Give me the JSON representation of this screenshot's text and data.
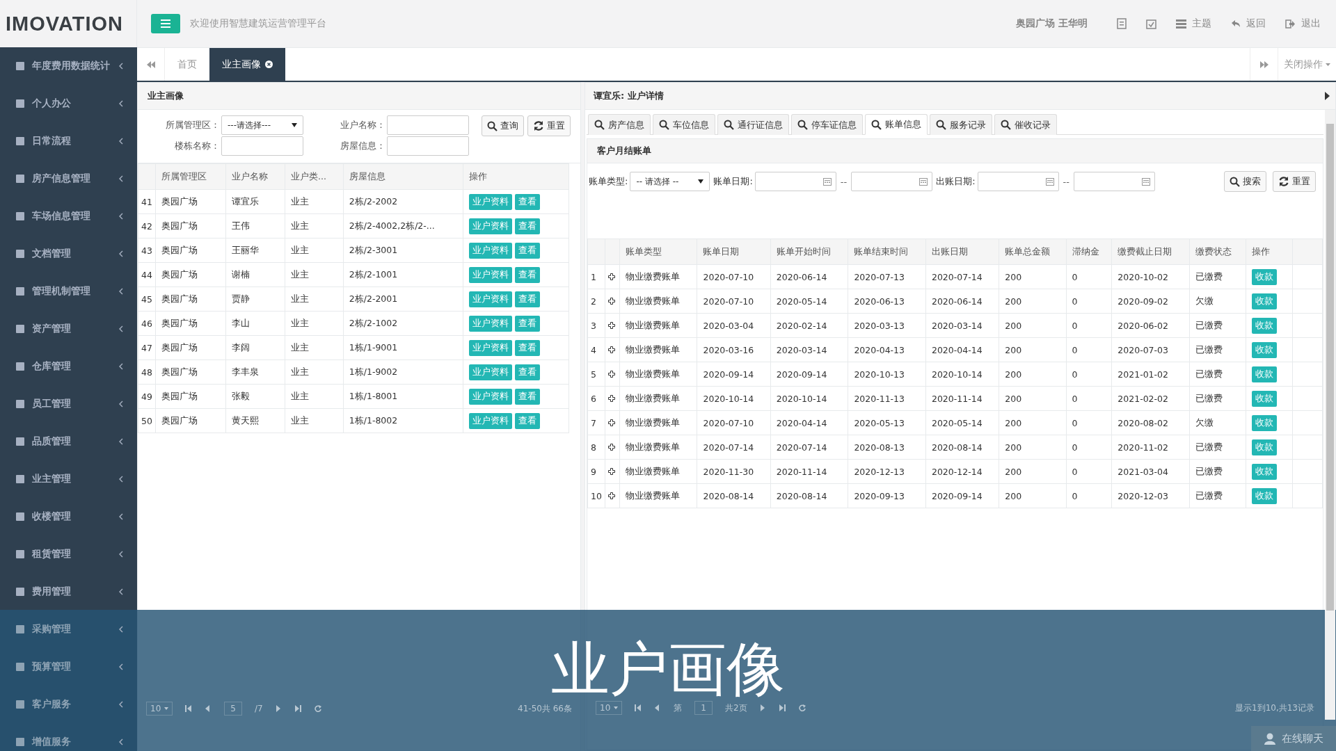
{
  "brand": {
    "logo": "IMOVATION"
  },
  "header": {
    "welcome": "欢迎使用智慧建筑运营管理平台",
    "user": "奥园广场 王华明",
    "actions": [
      {
        "kind": "doc"
      },
      {
        "kind": "calendar"
      },
      {
        "kind": "theme",
        "label": "主题"
      },
      {
        "kind": "back",
        "label": "返回"
      },
      {
        "kind": "logout",
        "label": "退出"
      }
    ]
  },
  "sidebar": {
    "items": [
      {
        "label": "年度费用数据统计"
      },
      {
        "label": "个人办公"
      },
      {
        "label": "日常流程"
      },
      {
        "label": "房产信息管理"
      },
      {
        "label": "车场信息管理"
      },
      {
        "label": "文档管理"
      },
      {
        "label": "管理机制管理"
      },
      {
        "label": "资产管理"
      },
      {
        "label": "仓库管理"
      },
      {
        "label": "员工管理"
      },
      {
        "label": "品质管理"
      },
      {
        "label": "业主管理"
      },
      {
        "label": "收楼管理"
      },
      {
        "label": "租赁管理"
      },
      {
        "label": "费用管理"
      },
      {
        "label": "采购管理"
      },
      {
        "label": "预算管理"
      },
      {
        "label": "客户服务"
      },
      {
        "label": "增值服务"
      }
    ]
  },
  "tabs": [
    {
      "label": "首页",
      "selected": false,
      "closable": false
    },
    {
      "label": "业主画像",
      "selected": true,
      "closable": true
    }
  ],
  "close_menu": "关闭操作",
  "left_panel": {
    "title": "业主画像",
    "filters": [
      {
        "label": "所属管理区：",
        "kind": "select",
        "value": "---请选择---"
      },
      {
        "label": "业户名称：",
        "kind": "input"
      },
      {
        "label": "楼栋名称：",
        "kind": "input"
      },
      {
        "label": "房屋信息：",
        "kind": "input"
      }
    ],
    "buttons": [
      {
        "kind": "search",
        "label": "查询"
      },
      {
        "kind": "reset",
        "label": "重置"
      }
    ],
    "table": {
      "columns": [
        "所属管理区",
        "业户名称",
        "业户类...",
        "房屋信息",
        "操作"
      ],
      "rows": [
        {
          "num": "41",
          "cells": [
            "奥园广场",
            "谭宜乐",
            "业主",
            "2栋/2-2002"
          ],
          "actions": [
            "业户资料",
            "查看"
          ]
        },
        {
          "num": "42",
          "cells": [
            "奥园广场",
            "王伟",
            "业主",
            "2栋/2-4002,2栋/2-..."
          ],
          "actions": [
            "业户资料",
            "查看"
          ]
        },
        {
          "num": "43",
          "cells": [
            "奥园广场",
            "王丽华",
            "业主",
            "2栋/2-3001"
          ],
          "actions": [
            "业户资料",
            "查看"
          ]
        },
        {
          "num": "44",
          "cells": [
            "奥园广场",
            "谢楠",
            "业主",
            "2栋/2-1001"
          ],
          "actions": [
            "业户资料",
            "查看"
          ]
        },
        {
          "num": "45",
          "cells": [
            "奥园广场",
            "贾静",
            "业主",
            "2栋/2-2001"
          ],
          "actions": [
            "业户资料",
            "查看"
          ]
        },
        {
          "num": "46",
          "cells": [
            "奥园广场",
            "李山",
            "业主",
            "2栋/2-1002"
          ],
          "actions": [
            "业户资料",
            "查看"
          ]
        },
        {
          "num": "47",
          "cells": [
            "奥园广场",
            "李阔",
            "业主",
            "1栋/1-9001"
          ],
          "actions": [
            "业户资料",
            "查看"
          ]
        },
        {
          "num": "48",
          "cells": [
            "奥园广场",
            "李丰泉",
            "业主",
            "1栋/1-9002"
          ],
          "actions": [
            "业户资料",
            "查看"
          ]
        },
        {
          "num": "49",
          "cells": [
            "奥园广场",
            "张毅",
            "业主",
            "1栋/1-8001"
          ],
          "actions": [
            "业户资料",
            "查看"
          ]
        },
        {
          "num": "50",
          "cells": [
            "奥园广场",
            "黄天熙",
            "业主",
            "1栋/1-8002"
          ],
          "actions": [
            "业户资料",
            "查看"
          ]
        }
      ]
    },
    "pager": {
      "page_size": "10",
      "page": "5",
      "pages": "/7",
      "info": "41-50共 66条"
    }
  },
  "right_panel": {
    "title": "谭宜乐: 业户详情",
    "subtabs": [
      {
        "label": "房产信息",
        "selected": false
      },
      {
        "label": "车位信息",
        "selected": false
      },
      {
        "label": "通行证信息",
        "selected": false
      },
      {
        "label": "停车证信息",
        "selected": false
      },
      {
        "label": "账单信息",
        "selected": true
      },
      {
        "label": "服务记录",
        "selected": false
      },
      {
        "label": "催收记录",
        "selected": false
      }
    ],
    "section_title": "客户月结账单",
    "filters": [
      {
        "label": "账单类型:",
        "kind": "select",
        "value": "-- 请选择 --"
      },
      {
        "label": "账单日期:",
        "kind": "daterange"
      },
      {
        "label": "出账日期:",
        "kind": "daterange"
      }
    ],
    "range_separator": [
      "--",
      "--"
    ],
    "buttons": [
      {
        "kind": "search",
        "label": "搜索"
      },
      {
        "kind": "reset",
        "label": "重置"
      }
    ],
    "table": {
      "columns": [
        "账单类型",
        "账单日期",
        "账单开始时间",
        "账单结束时间",
        "出账日期",
        "账单总金额",
        "滞纳金",
        "缴费截止日期",
        "缴费状态",
        "操作"
      ],
      "rows": [
        {
          "num": "1",
          "cells": [
            "物业缴费账单",
            "2020-07-10",
            "2020-06-14",
            "2020-07-13",
            "2020-07-14",
            "200",
            "0",
            "2020-10-02",
            "已缴费"
          ],
          "action": "收款"
        },
        {
          "num": "2",
          "cells": [
            "物业缴费账单",
            "2020-07-10",
            "2020-05-14",
            "2020-06-13",
            "2020-06-14",
            "200",
            "0",
            "2020-09-02",
            "欠缴"
          ],
          "action": "收款"
        },
        {
          "num": "3",
          "cells": [
            "物业缴费账单",
            "2020-03-04",
            "2020-02-14",
            "2020-03-13",
            "2020-03-14",
            "200",
            "0",
            "2020-06-02",
            "已缴费"
          ],
          "action": "收款"
        },
        {
          "num": "4",
          "cells": [
            "物业缴费账单",
            "2020-03-16",
            "2020-03-14",
            "2020-04-13",
            "2020-04-14",
            "200",
            "0",
            "2020-07-03",
            "已缴费"
          ],
          "action": "收款"
        },
        {
          "num": "5",
          "cells": [
            "物业缴费账单",
            "2020-09-14",
            "2020-09-14",
            "2020-10-13",
            "2020-10-14",
            "200",
            "0",
            "2021-01-02",
            "已缴费"
          ],
          "action": "收款"
        },
        {
          "num": "6",
          "cells": [
            "物业缴费账单",
            "2020-10-14",
            "2020-10-14",
            "2020-11-13",
            "2020-11-14",
            "200",
            "0",
            "2021-02-02",
            "已缴费"
          ],
          "action": "收款"
        },
        {
          "num": "7",
          "cells": [
            "物业缴费账单",
            "2020-07-10",
            "2020-04-14",
            "2020-05-13",
            "2020-05-14",
            "200",
            "0",
            "2020-08-02",
            "欠缴"
          ],
          "action": "收款"
        },
        {
          "num": "8",
          "cells": [
            "物业缴费账单",
            "2020-07-14",
            "2020-07-14",
            "2020-08-13",
            "2020-08-14",
            "200",
            "0",
            "2020-11-02",
            "已缴费"
          ],
          "action": "收款"
        },
        {
          "num": "9",
          "cells": [
            "物业缴费账单",
            "2020-11-30",
            "2020-11-14",
            "2020-12-13",
            "2020-12-14",
            "200",
            "0",
            "2021-03-04",
            "已缴费"
          ],
          "action": "收款"
        },
        {
          "num": "10",
          "cells": [
            "物业缴费账单",
            "2020-08-14",
            "2020-08-14",
            "2020-09-13",
            "2020-09-14",
            "200",
            "0",
            "2020-12-03",
            "已缴费"
          ],
          "action": "收款"
        }
      ]
    },
    "pager": {
      "page_size": "10",
      "page_label": "第",
      "page": "1",
      "pages": "共2页",
      "info": "显示1到10,共13记录"
    }
  },
  "caption": "业户画像",
  "chat": {
    "label": "在线聊天"
  }
}
